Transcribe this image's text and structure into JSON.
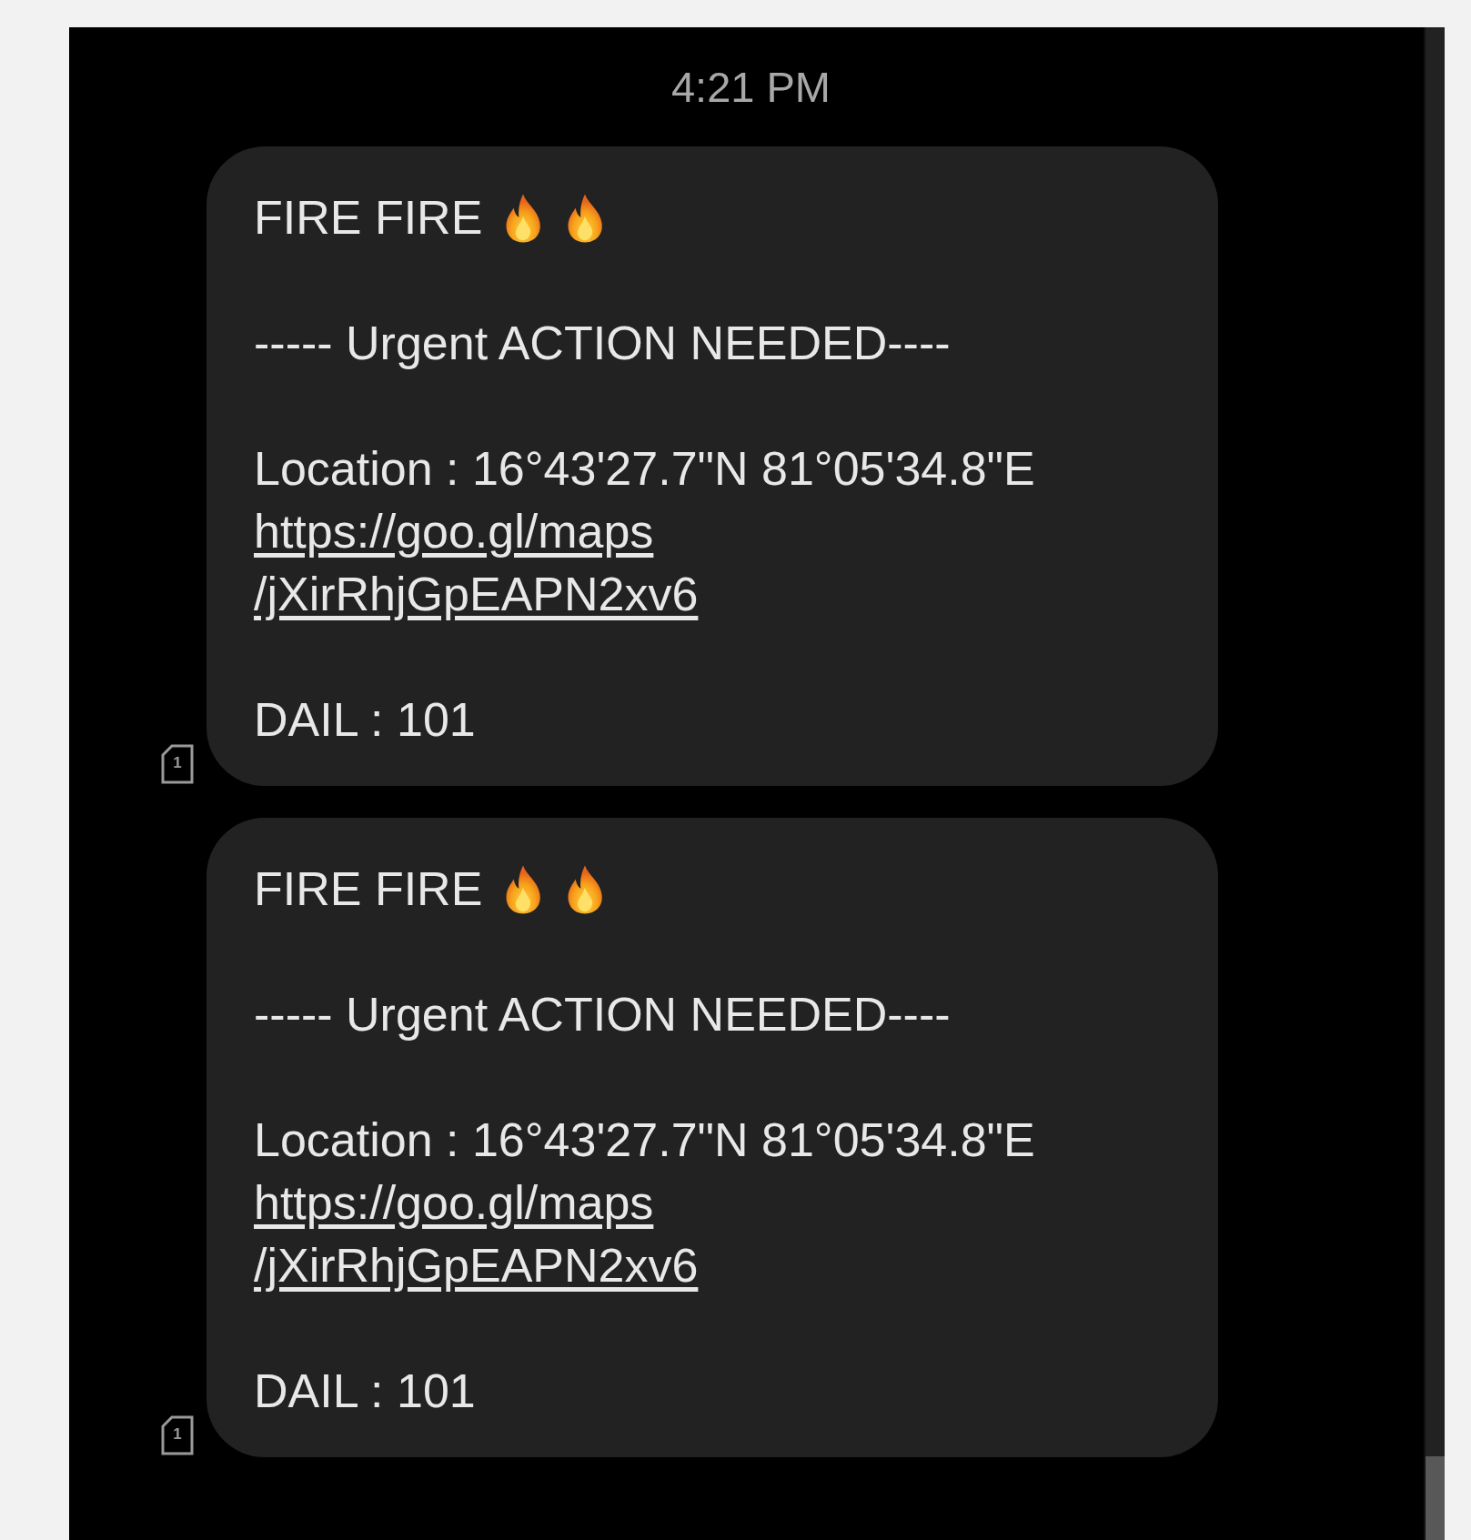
{
  "status_time": "4:21 PM",
  "messages": [
    {
      "sim_slot": "1",
      "title": "FIRE FIRE",
      "title_icons": [
        {
          "kind": "flame"
        },
        {
          "kind": "flame"
        }
      ],
      "headline": "----- Urgent ACTION NEEDED----",
      "location": "Location : 16°43'27.7\"N 81°05'34.8\"E",
      "link_lines": [
        "https://goo.gl/maps",
        "/jXirRhjGpEAPN2xv6"
      ],
      "dial": "DAIL : 101"
    },
    {
      "sim_slot": "1",
      "title": "FIRE FIRE",
      "title_icons": [
        {
          "kind": "flame"
        },
        {
          "kind": "flame"
        }
      ],
      "headline": "----- Urgent ACTION NEEDED----",
      "location": "Location : 16°43'27.7\"N 81°05'34.8\"E",
      "link_lines": [
        "https://goo.gl/maps",
        "/jXirRhjGpEAPN2xv6"
      ],
      "dial": "DAIL : 101"
    }
  ]
}
